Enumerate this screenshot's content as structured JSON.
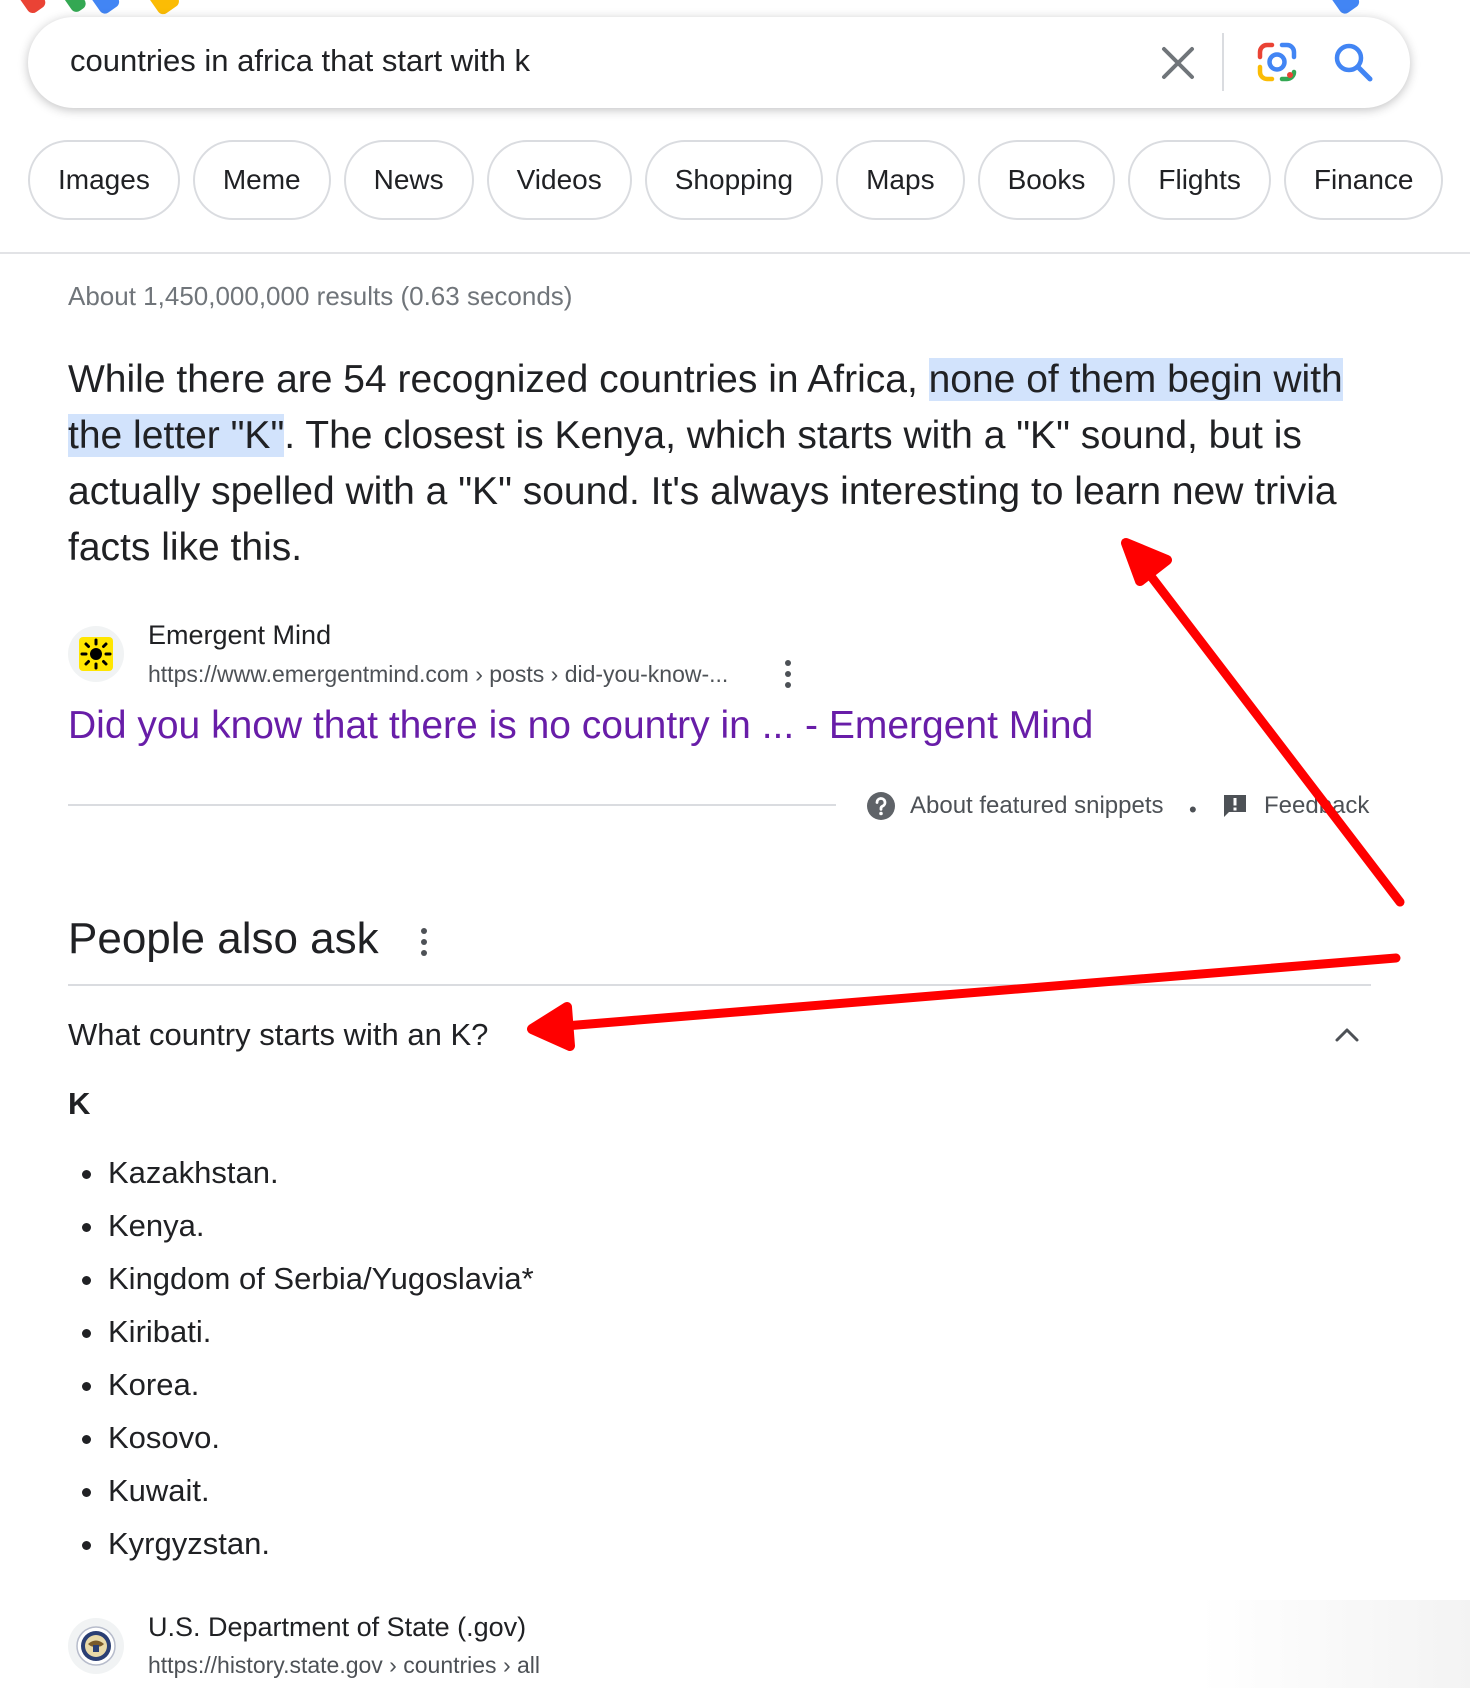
{
  "search": {
    "query": "countries in africa that start with k"
  },
  "chips": [
    "Images",
    "Meme",
    "News",
    "Videos",
    "Shopping",
    "Maps",
    "Books",
    "Flights",
    "Finance"
  ],
  "result_stats": "About 1,450,000,000 results (0.63 seconds)",
  "snippet": {
    "text_before": "While there are 54 recognized countries in Africa, ",
    "text_highlight": "none of them begin with the letter \"K\"",
    "text_after": ". The closest is Kenya, which starts with a \"K\" sound, but is actually spelled with a \"K\" sound. It's always interesting to learn new trivia facts like this.",
    "source_name": "Emergent Mind",
    "source_url": "https://www.emergentmind.com › posts › did-you-know-...",
    "link_title": "Did you know that there is no country in ... - Emergent Mind",
    "about_label": "About featured snippets",
    "separator": "•",
    "feedback_label": "Feedback"
  },
  "people_also_ask": {
    "title": "People also ask",
    "question": "What country starts with an K?",
    "answer_heading": "K",
    "answer_items": [
      "Kazakhstan.",
      "Kenya.",
      "Kingdom of Serbia/Yugoslavia*",
      "Kiribati.",
      "Korea.",
      "Kosovo.",
      "Kuwait.",
      "Kyrgyzstan."
    ],
    "source_name": "U.S. Department of State (.gov)",
    "source_url": "https://history.state.gov › countries › all"
  },
  "icons": {
    "clear": "close-icon",
    "lens": "google-lens-icon",
    "search": "search-icon",
    "help": "help-circle-icon",
    "feedback": "feedback-icon",
    "more": "more-vert-icon",
    "chevron": "chevron-up-icon"
  },
  "colors": {
    "link_visited": "#681da8",
    "highlight": "#d2e3fc",
    "search_blue": "#4285f4",
    "annotation_arrow": "#ff0000"
  }
}
